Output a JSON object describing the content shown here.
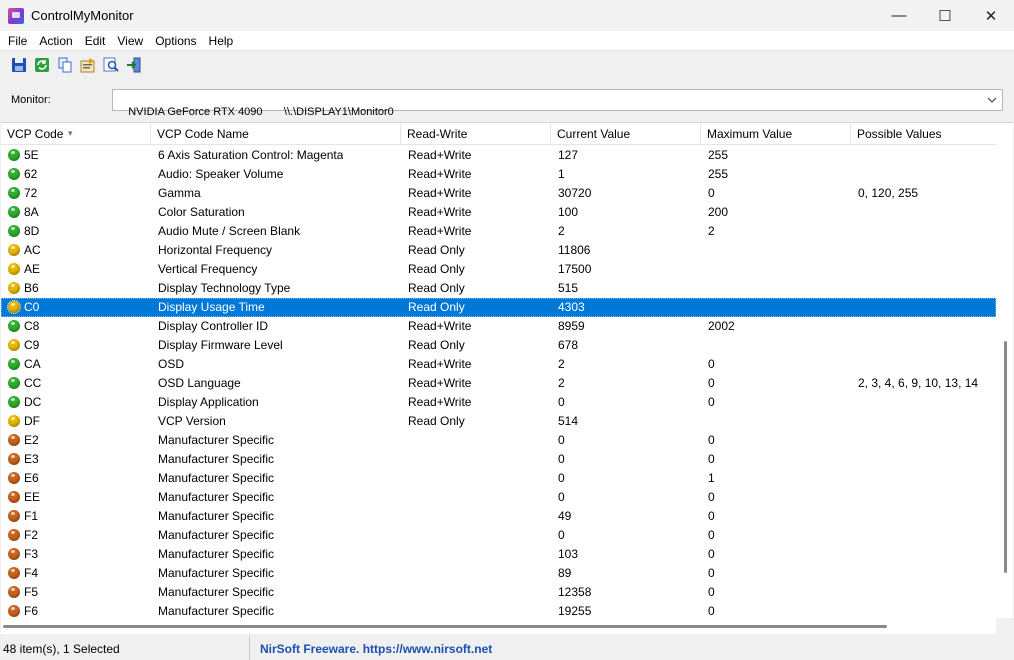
{
  "window": {
    "title": "ControlMyMonitor",
    "minimize": "—",
    "maximize": "☐",
    "close": "✕"
  },
  "menu": [
    "File",
    "Action",
    "Edit",
    "View",
    "Options",
    "Help"
  ],
  "toolbar": [
    {
      "icon": "save-icon"
    },
    {
      "icon": "refresh-icon"
    },
    {
      "icon": "copy-icon"
    },
    {
      "icon": "properties-icon"
    },
    {
      "icon": "find-icon"
    },
    {
      "icon": "exit-icon"
    }
  ],
  "monitor": {
    "label": "Monitor:",
    "value": "NVIDIA GeForce RTX 4090       \\\\.\\DISPLAY1\\Monitor0"
  },
  "columns": [
    "VCP Code",
    "VCP Code Name",
    "Read-Write",
    "Current Value",
    "Maximum Value",
    "Possible Values"
  ],
  "sort_indicator": "▾",
  "status_colors": {
    "rw": "#2fae2f",
    "ro": "#e6b800",
    "mfr": "#c8641e"
  },
  "rows": [
    {
      "status": "rw",
      "code": "5E",
      "name": "6 Axis Saturation Control: Magenta",
      "rw": "Read+Write",
      "current": "127",
      "max": "255",
      "possible": ""
    },
    {
      "status": "rw",
      "code": "62",
      "name": "Audio: Speaker Volume",
      "rw": "Read+Write",
      "current": "1",
      "max": "255",
      "possible": ""
    },
    {
      "status": "rw",
      "code": "72",
      "name": "Gamma",
      "rw": "Read+Write",
      "current": "30720",
      "max": "0",
      "possible": "0, 120, 255"
    },
    {
      "status": "rw",
      "code": "8A",
      "name": "Color Saturation",
      "rw": "Read+Write",
      "current": "100",
      "max": "200",
      "possible": ""
    },
    {
      "status": "rw",
      "code": "8D",
      "name": "Audio Mute / Screen Blank",
      "rw": "Read+Write",
      "current": "2",
      "max": "2",
      "possible": ""
    },
    {
      "status": "ro",
      "code": "AC",
      "name": "Horizontal Frequency",
      "rw": "Read Only",
      "current": "11806",
      "max": "",
      "possible": ""
    },
    {
      "status": "ro",
      "code": "AE",
      "name": "Vertical Frequency",
      "rw": "Read Only",
      "current": "17500",
      "max": "",
      "possible": ""
    },
    {
      "status": "ro",
      "code": "B6",
      "name": "Display Technology Type",
      "rw": "Read Only",
      "current": "515",
      "max": "",
      "possible": ""
    },
    {
      "status": "ro",
      "code": "C0",
      "name": "Display Usage Time",
      "rw": "Read Only",
      "current": "4303",
      "max": "",
      "possible": "",
      "selected": true
    },
    {
      "status": "rw",
      "code": "C8",
      "name": "Display Controller ID",
      "rw": "Read+Write",
      "current": "8959",
      "max": "2002",
      "possible": ""
    },
    {
      "status": "ro",
      "code": "C9",
      "name": "Display Firmware Level",
      "rw": "Read Only",
      "current": "678",
      "max": "",
      "possible": ""
    },
    {
      "status": "rw",
      "code": "CA",
      "name": "OSD",
      "rw": "Read+Write",
      "current": "2",
      "max": "0",
      "possible": ""
    },
    {
      "status": "rw",
      "code": "CC",
      "name": "OSD Language",
      "rw": "Read+Write",
      "current": "2",
      "max": "0",
      "possible": "2, 3, 4, 6, 9, 10, 13, 14"
    },
    {
      "status": "rw",
      "code": "DC",
      "name": "Display Application",
      "rw": "Read+Write",
      "current": "0",
      "max": "0",
      "possible": ""
    },
    {
      "status": "ro",
      "code": "DF",
      "name": "VCP Version",
      "rw": "Read Only",
      "current": "514",
      "max": "",
      "possible": ""
    },
    {
      "status": "mfr",
      "code": "E2",
      "name": "Manufacturer Specific",
      "rw": "",
      "current": "0",
      "max": "0",
      "possible": ""
    },
    {
      "status": "mfr",
      "code": "E3",
      "name": "Manufacturer Specific",
      "rw": "",
      "current": "0",
      "max": "0",
      "possible": ""
    },
    {
      "status": "mfr",
      "code": "E6",
      "name": "Manufacturer Specific",
      "rw": "",
      "current": "0",
      "max": "1",
      "possible": ""
    },
    {
      "status": "mfr",
      "code": "EE",
      "name": "Manufacturer Specific",
      "rw": "",
      "current": "0",
      "max": "0",
      "possible": ""
    },
    {
      "status": "mfr",
      "code": "F1",
      "name": "Manufacturer Specific",
      "rw": "",
      "current": "49",
      "max": "0",
      "possible": ""
    },
    {
      "status": "mfr",
      "code": "F2",
      "name": "Manufacturer Specific",
      "rw": "",
      "current": "0",
      "max": "0",
      "possible": ""
    },
    {
      "status": "mfr",
      "code": "F3",
      "name": "Manufacturer Specific",
      "rw": "",
      "current": "103",
      "max": "0",
      "possible": ""
    },
    {
      "status": "mfr",
      "code": "F4",
      "name": "Manufacturer Specific",
      "rw": "",
      "current": "89",
      "max": "0",
      "possible": ""
    },
    {
      "status": "mfr",
      "code": "F5",
      "name": "Manufacturer Specific",
      "rw": "",
      "current": "12358",
      "max": "0",
      "possible": ""
    },
    {
      "status": "mfr",
      "code": "F6",
      "name": "Manufacturer Specific",
      "rw": "",
      "current": "19255",
      "max": "0",
      "possible": ""
    }
  ],
  "status": {
    "count": "48 item(s), 1 Selected",
    "link": "NirSoft Freeware. https://www.nirsoft.net"
  }
}
